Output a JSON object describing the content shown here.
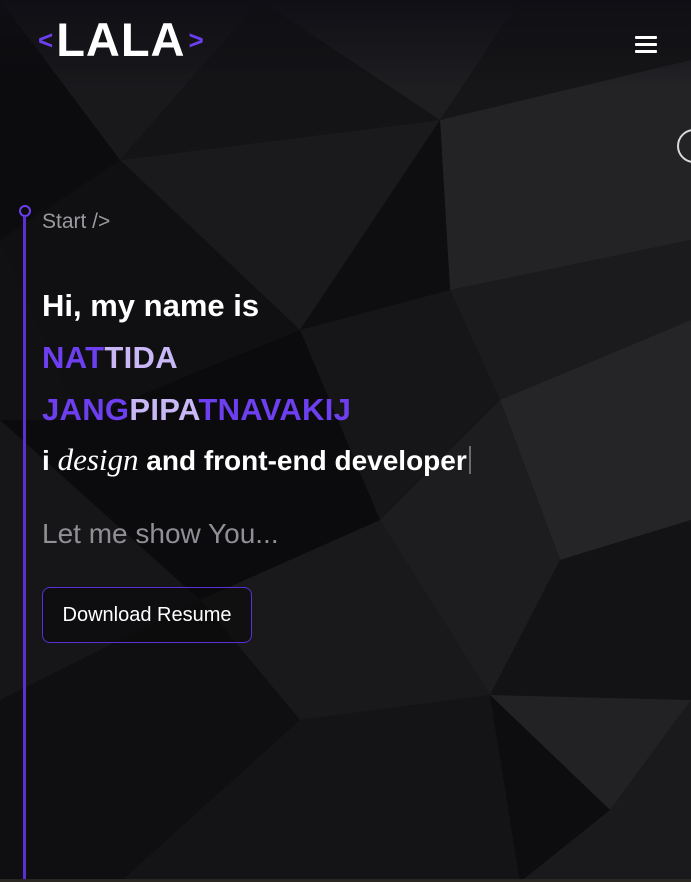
{
  "header": {
    "logo": {
      "bracket_left": "<",
      "name": "LALA",
      "bracket_right": ">"
    },
    "menu_icon": "hamburger-menu-icon"
  },
  "hero": {
    "start_tag": "Start />",
    "greeting": "Hi, my name is",
    "first_name": "NATTIDA",
    "last_name": "JANGPIPATNAVAKIJ",
    "tagline": {
      "prefix": "i",
      "emphasis": "design",
      "suffix": "and front-end developer"
    },
    "subline": "Let me show You...",
    "download_button": "Download Resume"
  },
  "colors": {
    "accent": "#6d3ff0",
    "accent_dark": "#5a2fd6",
    "name_light": "#c9b8f5",
    "background": "#0d0d0f",
    "text_primary": "#ffffff",
    "text_muted": "#9a9a9f"
  }
}
